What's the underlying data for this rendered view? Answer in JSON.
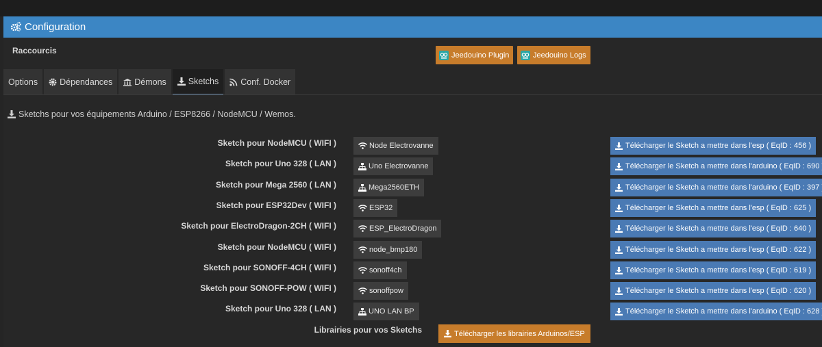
{
  "panel": {
    "title": "Configuration"
  },
  "shortcuts": {
    "label": "Raccourcis",
    "buttons": [
      {
        "label": "Jeedouino Plugin",
        "icon": "jeedouino-logo-icon"
      },
      {
        "label": "Jeedouino Logs",
        "icon": "jeedouino-logo-icon"
      }
    ]
  },
  "tabs": [
    {
      "label": "Options",
      "icon": ""
    },
    {
      "label": "Dépendances",
      "icon": "cog-icon"
    },
    {
      "label": "Démons",
      "icon": "bank-icon"
    },
    {
      "label": "Sketchs",
      "icon": "download-icon",
      "active": true
    },
    {
      "label": "Conf. Docker",
      "icon": "rss-icon"
    }
  ],
  "section": {
    "title": "Sketchs pour vos équipements Arduino / ESP8266 / NodeMCU / Wemos."
  },
  "rows": [
    {
      "label": "Sketch pour NodeMCU ( WIFI )",
      "device": "Node Electrovanne",
      "conn": "wifi",
      "download": "Télécharger le Sketch a mettre dans l'esp ( EqID : 456 )"
    },
    {
      "label": "Sketch pour Uno 328 ( LAN )",
      "device": "Uno Electrovanne",
      "conn": "lan",
      "download": "Télécharger le Sketch a mettre dans l'arduino ( EqID : 690 )"
    },
    {
      "label": "Sketch pour Mega 2560 ( LAN )",
      "device": "Mega2560ETH",
      "conn": "lan",
      "download": "Télécharger le Sketch a mettre dans l'arduino ( EqID : 397 )"
    },
    {
      "label": "Sketch pour ESP32Dev ( WIFI )",
      "device": "ESP32",
      "conn": "wifi",
      "download": "Télécharger le Sketch a mettre dans l'esp ( EqID : 625 )"
    },
    {
      "label": "Sketch pour ElectroDragon-2CH ( WIFI )",
      "device": "ESP_ElectroDragon",
      "conn": "wifi",
      "download": "Télécharger le Sketch a mettre dans l'esp ( EqID : 640 )"
    },
    {
      "label": "Sketch pour NodeMCU ( WIFI )",
      "device": "node_bmp180",
      "conn": "wifi",
      "download": "Télécharger le Sketch a mettre dans l'esp ( EqID : 622 )"
    },
    {
      "label": "Sketch pour SONOFF-4CH ( WIFI )",
      "device": "sonoff4ch",
      "conn": "wifi",
      "download": "Télécharger le Sketch a mettre dans l'esp ( EqID : 619 )"
    },
    {
      "label": "Sketch pour SONOFF-POW ( WIFI )",
      "device": "sonoffpow",
      "conn": "wifi",
      "download": "Télécharger le Sketch a mettre dans l'esp ( EqID : 620 )"
    },
    {
      "label": "Sketch pour Uno 328 ( LAN )",
      "device": "UNO LAN BP",
      "conn": "lan",
      "download": "Télécharger le Sketch a mettre dans l'arduino ( EqID : 628 )"
    }
  ],
  "libraries": {
    "label": "Librairies pour vos Sketchs",
    "button": "Télécharger les librairies Arduinos/ESP"
  },
  "colors": {
    "header": "#3c86c4",
    "orange": "#c77c2b",
    "blue_button": "#4a7ab4",
    "dark_button": "#3d3d3d"
  }
}
